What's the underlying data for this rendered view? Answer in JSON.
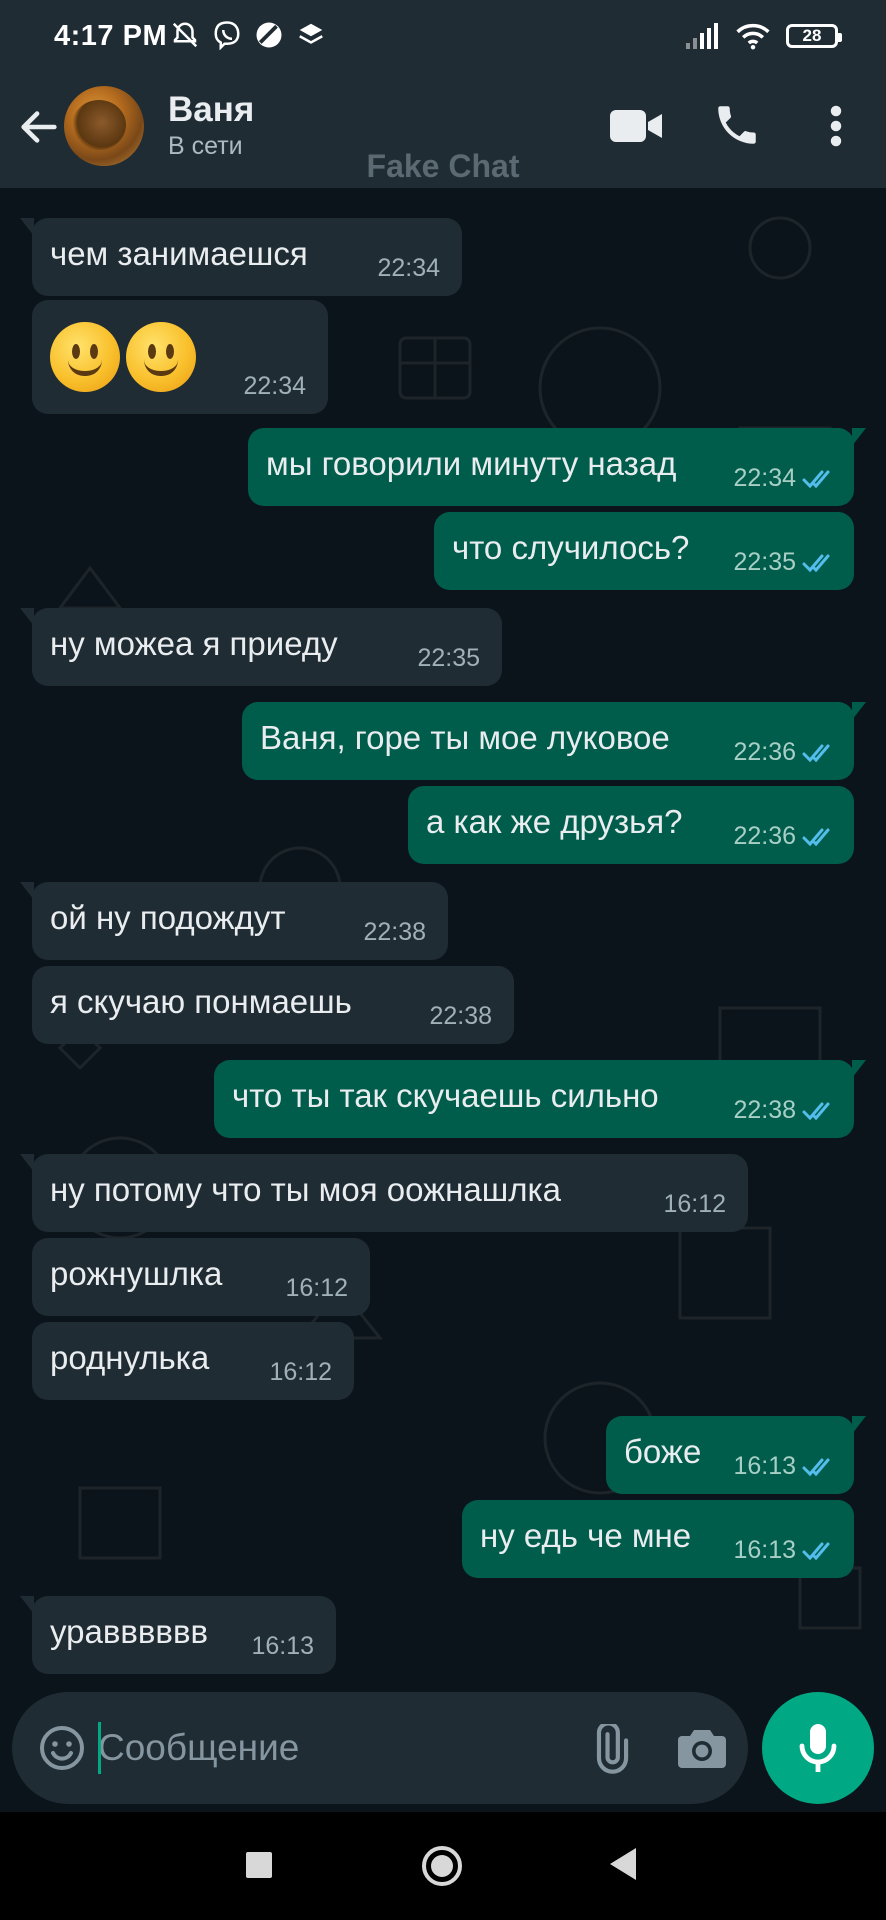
{
  "status_bar": {
    "time": "4:17 PM",
    "left_icons": [
      "mute-bell-icon",
      "viber-icon",
      "no-entry-icon",
      "layers-icon"
    ],
    "right_icons": [
      "signal-icon",
      "wifi-icon",
      "battery-icon"
    ],
    "battery": "28"
  },
  "header": {
    "contact_name": "Ваня",
    "contact_status": "В сети",
    "watermark": "Fake Chat",
    "icons": [
      "back-arrow-icon",
      "video-call-icon",
      "phone-icon",
      "more-vert-icon"
    ]
  },
  "messages": [
    {
      "dir": "in",
      "text": "чем занимаешся",
      "time": "22:34"
    },
    {
      "dir": "in",
      "text": "🙂🙂",
      "time": "22:34",
      "emoji": true
    },
    {
      "dir": "out",
      "text": "мы говорили минуту назад",
      "time": "22:34",
      "read": true
    },
    {
      "dir": "out",
      "text": "что случилось?",
      "time": "22:35",
      "read": true
    },
    {
      "dir": "in",
      "text": "ну можеа я приеду",
      "time": "22:35"
    },
    {
      "dir": "out",
      "text": "Ваня, горе ты мое луковое",
      "time": "22:36",
      "read": true
    },
    {
      "dir": "out",
      "text": "а как же друзья?",
      "time": "22:36",
      "read": true
    },
    {
      "dir": "in",
      "text": "ой ну подождут",
      "time": "22:38"
    },
    {
      "dir": "in",
      "text": "я скучаю понмаешь",
      "time": "22:38"
    },
    {
      "dir": "out",
      "text": "что ты так скучаешь сильно",
      "time": "22:38",
      "read": true
    },
    {
      "dir": "in",
      "text": "ну потому что ты моя оожнашлка",
      "time": "16:12"
    },
    {
      "dir": "in",
      "text": "рожнушлка",
      "time": "16:12"
    },
    {
      "dir": "in",
      "text": "роднулька",
      "time": "16:12"
    },
    {
      "dir": "out",
      "text": "боже",
      "time": "16:13",
      "read": true
    },
    {
      "dir": "out",
      "text": "ну едь че мне",
      "time": "16:13",
      "read": true
    },
    {
      "dir": "in",
      "text": "уравввввв",
      "time": "16:13"
    }
  ],
  "input": {
    "placeholder": "Сообщение",
    "value": "",
    "icons": [
      "emoji-icon",
      "paperclip-icon",
      "camera-icon",
      "mic-icon"
    ]
  },
  "nav": {
    "icons": [
      "recent-apps-icon",
      "home-icon",
      "back-triangle-icon"
    ]
  },
  "colors": {
    "background": "#0b141a",
    "header": "#1f2c34",
    "incoming_bubble": "#202c33",
    "outgoing_bubble": "#005c4b",
    "accent": "#00a884",
    "read_ticks": "#53bdeb"
  }
}
